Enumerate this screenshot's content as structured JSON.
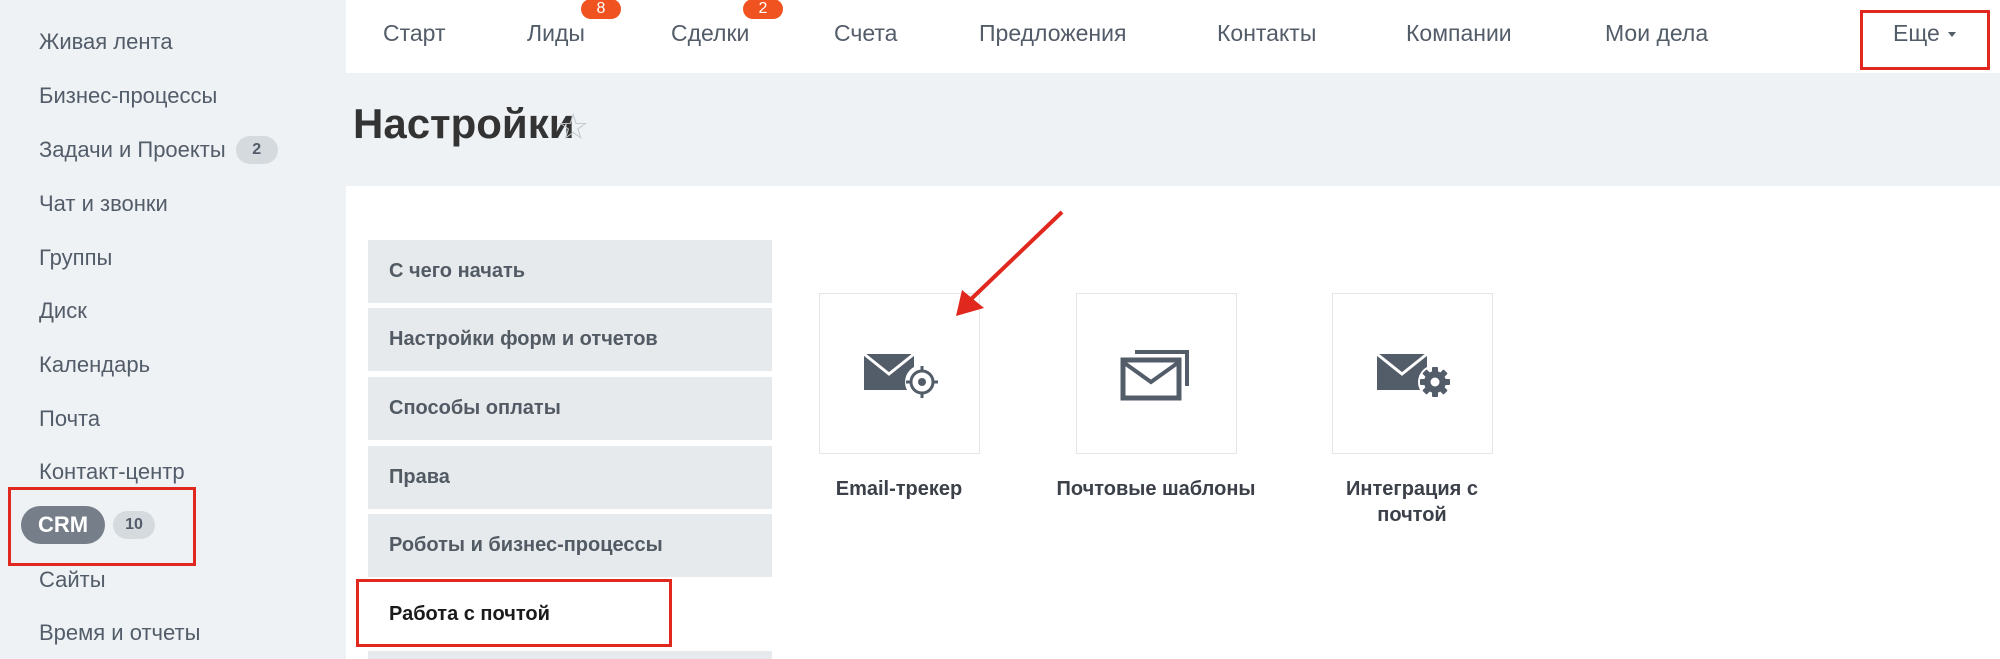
{
  "sidebar": {
    "items": [
      {
        "label": "Живая лента"
      },
      {
        "label": "Бизнес-процессы"
      },
      {
        "label": "Задачи и Проекты",
        "counter": "2"
      },
      {
        "label": "Чат и звонки"
      },
      {
        "label": "Группы"
      },
      {
        "label": "Диск"
      },
      {
        "label": "Календарь"
      },
      {
        "label": "Почта"
      },
      {
        "label": "Контакт-центр"
      },
      {
        "label": "CRM",
        "counter": "10"
      },
      {
        "label": "Сайты"
      },
      {
        "label": "Время и отчеты"
      }
    ]
  },
  "topnav": {
    "items": [
      {
        "label": "Старт"
      },
      {
        "label": "Лиды",
        "badge": "8"
      },
      {
        "label": "Сделки",
        "badge": "2"
      },
      {
        "label": "Счета"
      },
      {
        "label": "Предложения"
      },
      {
        "label": "Контакты"
      },
      {
        "label": "Компании"
      },
      {
        "label": "Мои дела"
      }
    ],
    "more_label": "Еще"
  },
  "page": {
    "title": "Настройки",
    "star": "☆"
  },
  "settings_menu": {
    "items": [
      {
        "label": "С чего начать"
      },
      {
        "label": "Настройки форм и отчетов"
      },
      {
        "label": "Способы оплаты"
      },
      {
        "label": "Права"
      },
      {
        "label": "Роботы и бизнес-процессы"
      },
      {
        "label": "Работа с почтой",
        "active": true
      }
    ]
  },
  "tiles": [
    {
      "label": "Email-трекер",
      "icon": "email-tracker-icon"
    },
    {
      "label": "Почтовые шаблоны",
      "icon": "mail-templates-icon"
    },
    {
      "label": "Интеграция с почтой",
      "icon": "mail-integration-icon"
    }
  ],
  "colors": {
    "accent_red": "#e0281f",
    "badge_orange": "#f0531f",
    "crm_pill": "#767f89",
    "icon_gray": "#535c69"
  }
}
